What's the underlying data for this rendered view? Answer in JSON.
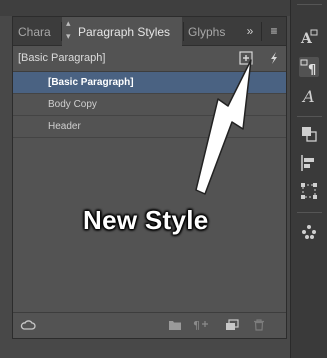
{
  "tabs": [
    {
      "label": "Chara",
      "active": false
    },
    {
      "label": "Paragraph Styles",
      "active": true
    },
    {
      "label": "Glyphs",
      "active": false
    }
  ],
  "tab_controls": {
    "collapse": "»",
    "menu": "≡"
  },
  "control_row": {
    "current_style": "[Basic Paragraph]"
  },
  "styles": [
    {
      "label": "[Basic Paragraph]",
      "selected": true
    },
    {
      "label": "Body Copy",
      "selected": false
    },
    {
      "label": "Header",
      "selected": false
    }
  ],
  "bottom_icons": [
    "cloud-library-icon",
    "folder-icon",
    "clear-overrides-icon",
    "new-style-icon",
    "trash-icon"
  ],
  "dock_icons": [
    "character-styles-icon",
    "paragraph-styles-icon",
    "glyphs-icon",
    "pathfinder-icon",
    "align-icon",
    "transform-icon",
    "swatches-icon"
  ],
  "annotation": {
    "label": "New Style"
  },
  "colors": {
    "selection": "#4a6282",
    "panel": "#535353",
    "tabbar": "#3c3c3c"
  }
}
